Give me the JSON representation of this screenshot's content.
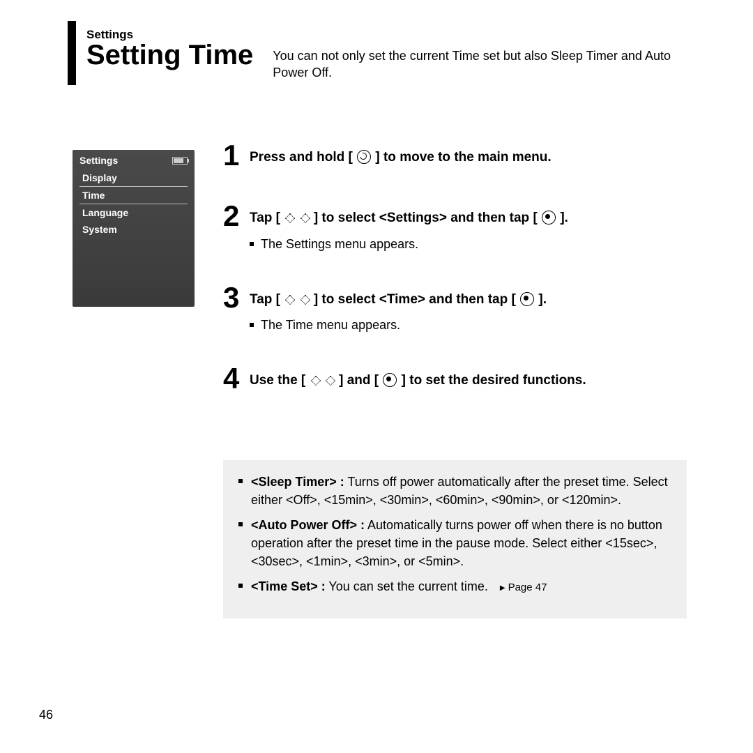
{
  "header": {
    "category": "Settings",
    "title": "Setting Time",
    "desc": "You can not only set the current Time set but also Sleep Timer and Auto Power Off."
  },
  "device": {
    "title": "Settings",
    "items": [
      "Display",
      "Time",
      "Language",
      "System"
    ],
    "selectedIndex": 1
  },
  "steps": [
    {
      "num": "1",
      "title_before": "Press and hold [ ",
      "icon1": "circlearrow",
      "title_after": " ] to move to the main menu.",
      "sub": ""
    },
    {
      "num": "2",
      "title_before": "Tap [ ",
      "icon1": "diamond-left",
      "icon2": "diamond-right",
      "title_mid": " ] to select <Settings> and then tap [ ",
      "icon3": "target",
      "title_after": " ].",
      "sub": "The Settings menu appears."
    },
    {
      "num": "3",
      "title_before": "Tap [ ",
      "icon1": "diamond-up",
      "icon2": "diamond-down",
      "title_mid": " ] to select <Time> and then tap [ ",
      "icon3": "target",
      "title_after": " ].",
      "sub": "The Time menu appears."
    },
    {
      "num": "4",
      "title_before": "Use the [ ",
      "icon1": "diamond-up",
      "icon2": "diamond-down",
      "title_mid": " ] and [ ",
      "icon3": "target",
      "title_after": " ] to set the desired functions.",
      "sub": ""
    }
  ],
  "info": {
    "sleep_label": "<Sleep Timer> :",
    "sleep_text": " Turns off power automatically after the preset time. Select either <Off>, <15min>, <30min>, <60min>, <90min>, or <120min>.",
    "auto_label": "<Auto Power Off> :",
    "auto_text": " Automatically turns power off when there is no button operation after the preset time in the pause mode. Select either <15sec>, <30sec>, <1min>, <3min>, or <5min>.",
    "timeset_label": "<Time Set> :",
    "timeset_text": " You can set the current time.",
    "timeset_pageref": "Page 47"
  },
  "pagenum": "46"
}
